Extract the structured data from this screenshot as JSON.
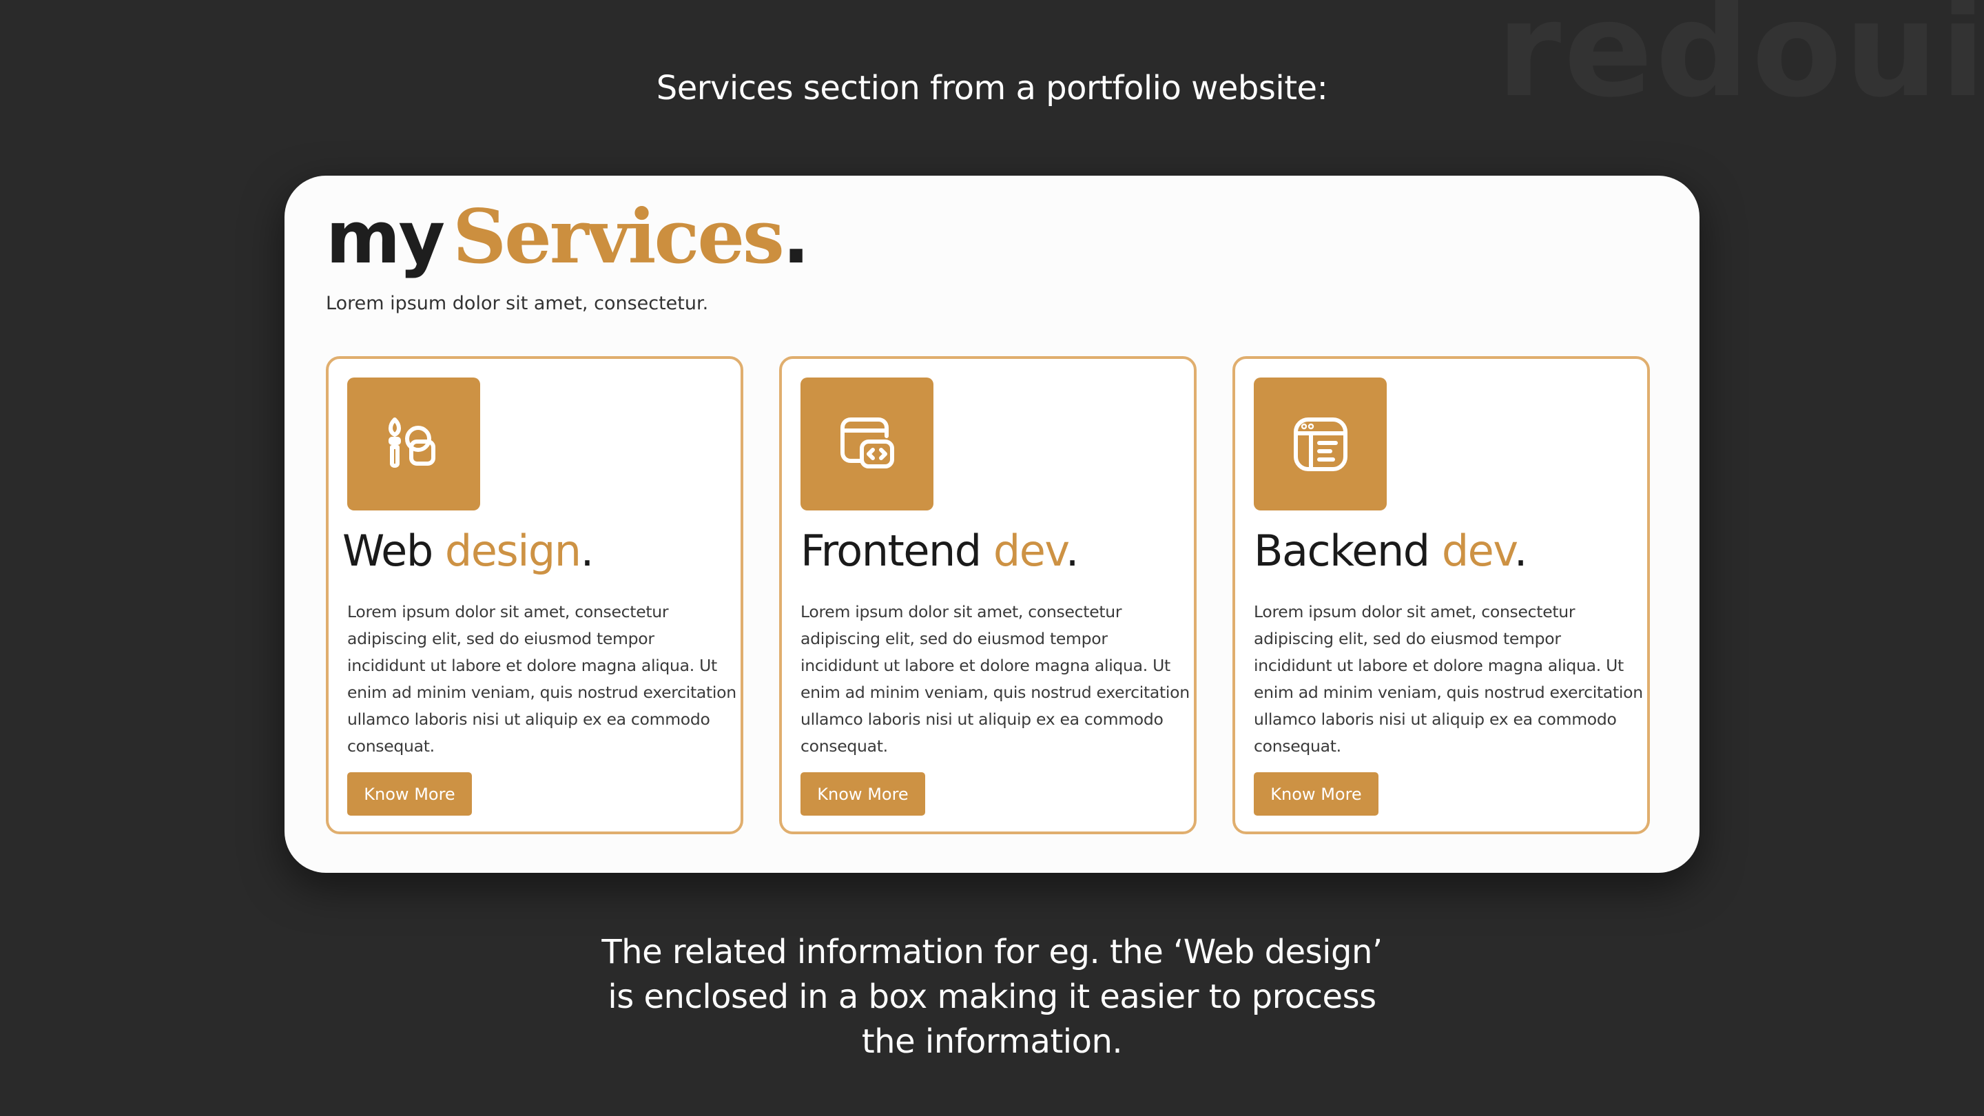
{
  "watermark": "redoui",
  "heading": "Services section from a portfolio website:",
  "section": {
    "title_part1": "my",
    "title_part2": "Services",
    "title_dot": ".",
    "subtitle": "Lorem ipsum dolor sit amet, consectetur."
  },
  "cards": [
    {
      "icon": "brush-shapes-icon",
      "title_main": "Web",
      "title_accent": "design",
      "title_dot": ".",
      "description": "Lorem ipsum dolor sit amet, consectetur adipiscing elit, sed do eiusmod tempor incididunt ut labore et dolore magna aliqua. Ut enim ad minim veniam, quis nostrud exercitation ullamco laboris nisi ut aliquip ex ea commodo consequat.",
      "button_label": "Know More"
    },
    {
      "icon": "code-window-icon",
      "title_main": "Frontend",
      "title_accent": "dev",
      "title_dot": ".",
      "description": "Lorem ipsum dolor sit amet, consectetur adipiscing elit, sed do eiusmod tempor incididunt ut labore et dolore magna aliqua. Ut enim ad minim veniam, quis nostrud exercitation ullamco laboris nisi ut aliquip ex ea commodo consequat.",
      "button_label": "Know More"
    },
    {
      "icon": "server-layout-icon",
      "title_main": "Backend",
      "title_accent": "dev",
      "title_dot": ".",
      "description": "Lorem ipsum dolor sit amet, consectetur adipiscing elit, sed do eiusmod tempor incididunt ut labore et dolore magna aliqua. Ut enim ad minim veniam, quis nostrud exercitation ullamco laboris nisi ut aliquip ex ea commodo consequat.",
      "button_label": "Know More"
    }
  ],
  "caption": {
    "line1": "The related information for eg. the ‘Web design’",
    "line2": "is enclosed in a box making it easier to process",
    "line3": "the information."
  },
  "colors": {
    "background": "#2a2a2a",
    "panel": "#fcfcfc",
    "accent": "#cd9244",
    "card_border": "#e0ae6e",
    "dark_text": "#1a1a1a"
  }
}
